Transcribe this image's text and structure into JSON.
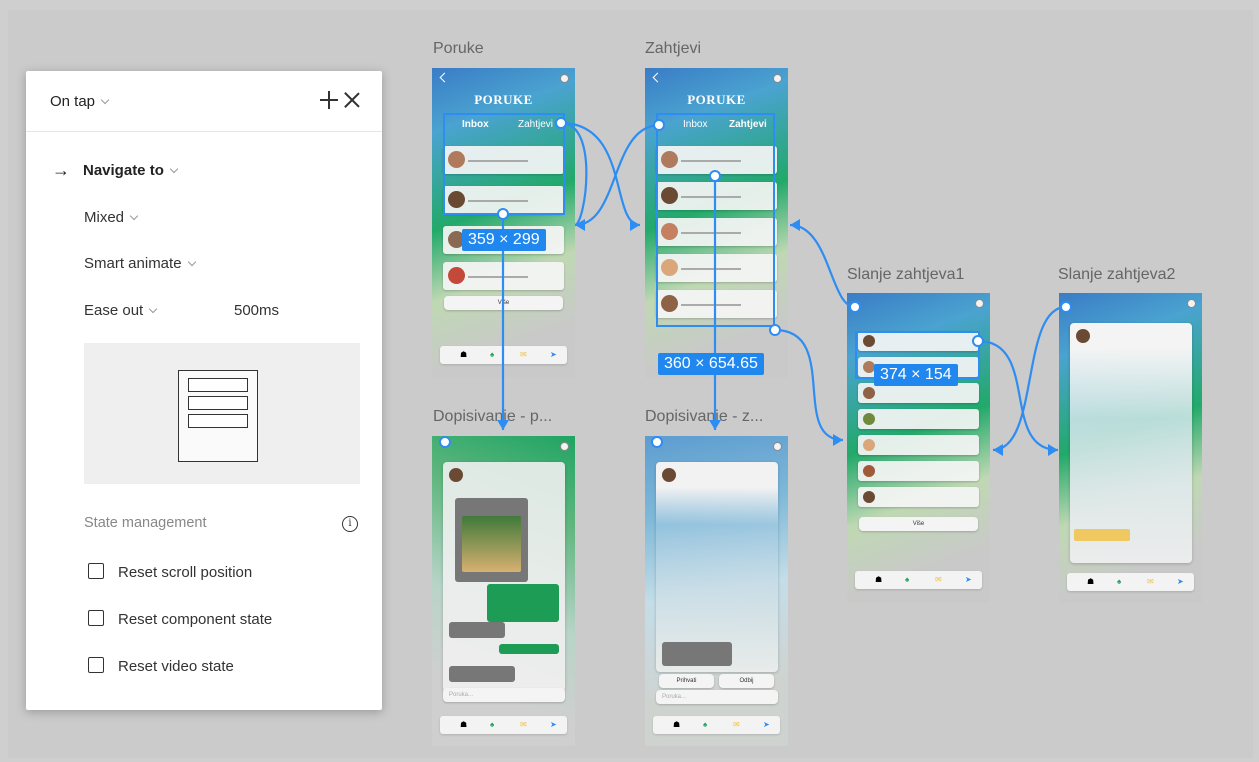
{
  "panel": {
    "trigger": "On tap",
    "action": "Navigate to",
    "destination": "Mixed",
    "animation": "Smart animate",
    "easing": "Ease out",
    "duration": "500ms",
    "state_label": "State management",
    "checkboxes": [
      "Reset scroll position",
      "Reset component state",
      "Reset video state"
    ]
  },
  "frames": {
    "poruke": "Poruke",
    "zahtjevi": "Zahtjevi",
    "dopisivanje1": "Dopisivanje - p...",
    "dopisivanje2": "Dopisivanje - z...",
    "slanje1": "Slanje zahtjeva1",
    "slanje2": "Slanje zahtjeva2"
  },
  "phone": {
    "heading": "PORUKE",
    "tab_inbox": "Inbox",
    "tab_requests": "Zahtjevi",
    "more": "Više",
    "accept": "Prihvati",
    "reject": "Odbij",
    "search_placeholder": "Poruka..."
  },
  "dimensions": {
    "d1": "359 × 299",
    "d2": "360 × 654.65",
    "d3": "374 × 154"
  },
  "colors": {
    "accent": "#2e8df2",
    "green": "#22a96a"
  },
  "icons": [
    "chevron-down-icon",
    "plus-icon",
    "close-icon",
    "arrow-right-icon",
    "info-icon",
    "home-icon",
    "back-icon"
  ]
}
